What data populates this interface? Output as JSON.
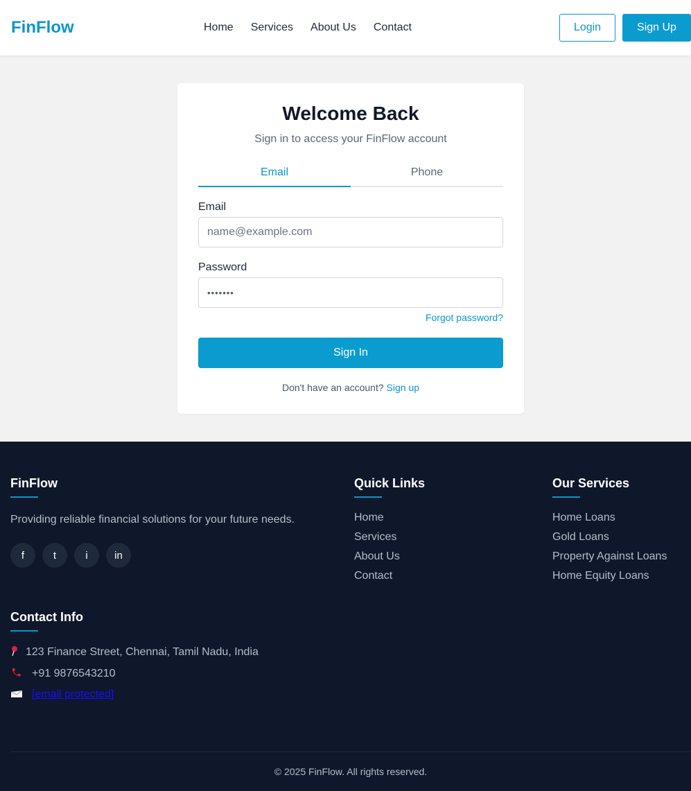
{
  "header": {
    "brand": "FinFlow",
    "nav": [
      "Home",
      "Services",
      "About Us",
      "Contact"
    ],
    "login_label": "Login",
    "signup_label": "Sign Up"
  },
  "card": {
    "title": "Welcome Back",
    "subtitle": "Sign in to access your FinFlow account",
    "tabs": [
      "Email",
      "Phone"
    ],
    "email_label": "Email",
    "email_placeholder": "name@example.com",
    "password_label": "Password",
    "password_value": "•••••••",
    "forgot": "Forgot password?",
    "signin_label": "Sign In",
    "no_account": "Don't have an account?",
    "signup_link": "Sign up"
  },
  "footer": {
    "brand": "FinFlow",
    "description": "Providing reliable financial solutions for your future needs.",
    "social": [
      "f",
      "t",
      "i",
      "in"
    ],
    "quick_links_title": "Quick Links",
    "quick_links": [
      "Home",
      "Services",
      "About Us",
      "Contact"
    ],
    "services_title": "Our Services",
    "services": [
      "Home Loans",
      "Gold Loans",
      "Property Against Loans",
      "Home Equity Loans"
    ],
    "contact_title": "Contact Info",
    "address": "123 Finance Street, Chennai, Tamil Nadu, India",
    "phone": "+91 9876543210",
    "email": "[email protected]",
    "copyright": "© 2025 FinFlow. All rights reserved."
  },
  "colors": {
    "accent": "#0b96c9",
    "footer_bg": "#0f172a",
    "page_bg": "#f2f2f2"
  },
  "icons": [
    "map-pin-icon",
    "phone-icon",
    "envelope-icon"
  ]
}
